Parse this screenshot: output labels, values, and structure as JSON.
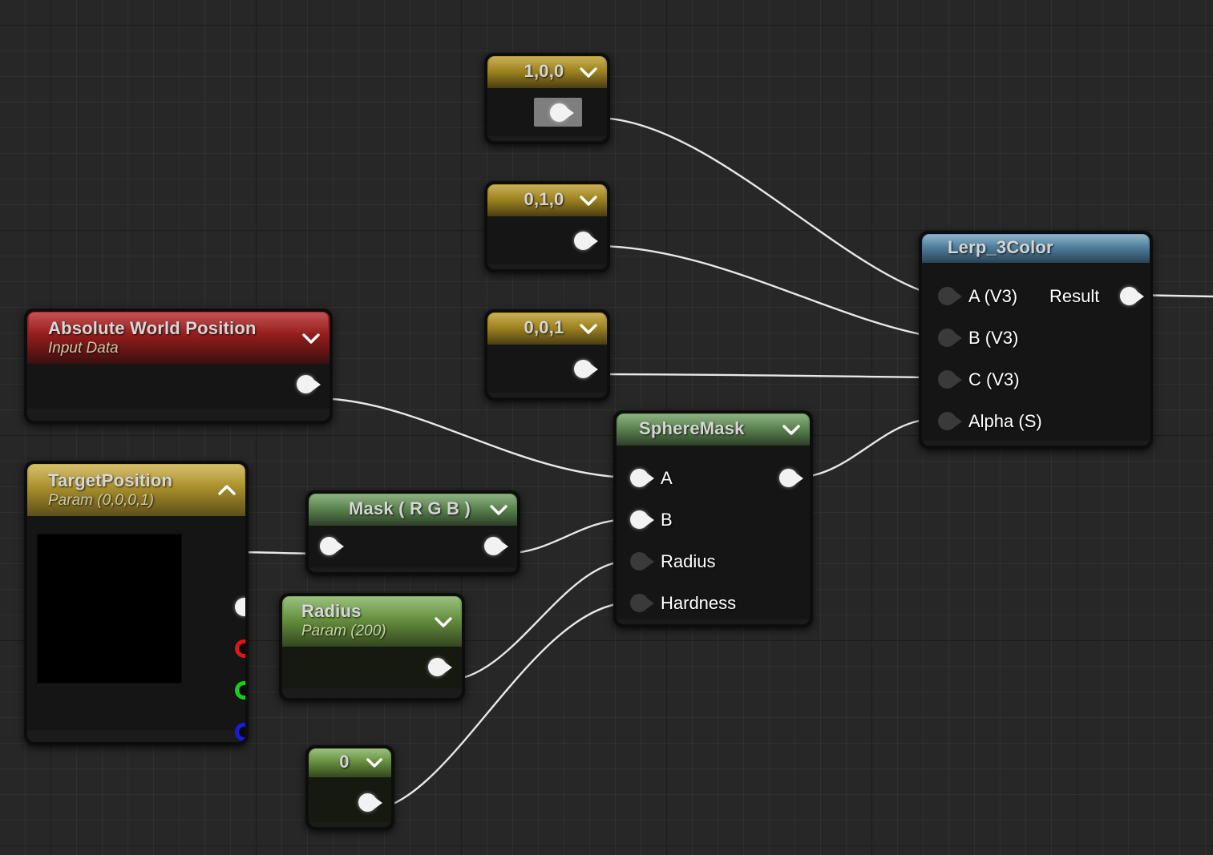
{
  "graph": {
    "title": "Unreal Material Graph",
    "background_color": "#272727",
    "grid_minor_color": "#2f2f2f",
    "grid_major_color": "#1a1a1a",
    "wire_color": "#e8e8e8"
  },
  "nodes": {
    "const_100": {
      "title": "1,0,0",
      "header_color": "#9d8220",
      "chevron": "chevron-down-icon",
      "output_pin": "output-pin",
      "pin_hovered": true
    },
    "const_010": {
      "title": "0,1,0",
      "header_color": "#9d8220",
      "chevron": "chevron-down-icon",
      "output_pin": "output-pin"
    },
    "const_001": {
      "title": "0,0,1",
      "header_color": "#9d8220",
      "chevron": "chevron-down-icon",
      "output_pin": "output-pin"
    },
    "absolute_world_position": {
      "title": "Absolute World Position",
      "subtitle": "Input Data",
      "header_color": "#941c1c",
      "chevron": "chevron-down-icon",
      "output_pin": "output-pin"
    },
    "target_position": {
      "title": "TargetPosition",
      "subtitle": "Param (0,0,0,1)",
      "header_color": "#a98f2c",
      "chevron": "chevron-up-icon",
      "preview_color": "#000000",
      "outputs": [
        {
          "name": "rgba",
          "style": "filled"
        },
        {
          "name": "r",
          "style": "ring-red",
          "color": "#e01414"
        },
        {
          "name": "g",
          "style": "ring-green",
          "color": "#13d413"
        },
        {
          "name": "b",
          "style": "ring-blue",
          "color": "#1a1ae0"
        },
        {
          "name": "a",
          "style": "ring-alpha",
          "color": "#bfbfbf"
        }
      ]
    },
    "mask_rgb": {
      "title": "Mask ( R G B )",
      "header_color": "#5b8450",
      "chevron": "chevron-down-icon",
      "input_pin": "input-pin",
      "output_pin": "output-pin"
    },
    "radius_param": {
      "title": "Radius",
      "subtitle": "Param (200)",
      "header_color": "#66913f",
      "chevron": "chevron-down-icon",
      "output_pin": "output-pin"
    },
    "const_zero": {
      "title": "0",
      "header_color": "#66913f",
      "chevron": "chevron-down-icon",
      "output_pin": "output-pin"
    },
    "sphere_mask": {
      "title": "SphereMask",
      "header_color": "#5b8450",
      "chevron": "chevron-down-icon",
      "inputs": [
        {
          "label": "A",
          "style": "filled"
        },
        {
          "label": "B",
          "style": "filled"
        },
        {
          "label": "Radius",
          "style": "empty"
        },
        {
          "label": "Hardness",
          "style": "empty"
        }
      ],
      "output_pin": "output-pin"
    },
    "lerp_3color": {
      "title": "Lerp_3Color",
      "header_color": "#4d7c99",
      "inputs": [
        {
          "label": "A (V3)",
          "style": "empty"
        },
        {
          "label": "B (V3)",
          "style": "empty"
        },
        {
          "label": "C (V3)",
          "style": "empty"
        },
        {
          "label": "Alpha (S)",
          "style": "empty"
        }
      ],
      "output_label": "Result",
      "output_pin": "output-pin"
    }
  },
  "connections": [
    {
      "from": "const_100",
      "to": "lerp_3color.A"
    },
    {
      "from": "const_010",
      "to": "lerp_3color.B"
    },
    {
      "from": "const_001",
      "to": "lerp_3color.C"
    },
    {
      "from": "absolute_world_position",
      "to": "sphere_mask.A"
    },
    {
      "from": "target_position.rgba",
      "to": "mask_rgb.input"
    },
    {
      "from": "mask_rgb",
      "to": "sphere_mask.B"
    },
    {
      "from": "radius_param",
      "to": "sphere_mask.Radius"
    },
    {
      "from": "const_zero",
      "to": "sphere_mask.Hardness"
    },
    {
      "from": "sphere_mask",
      "to": "lerp_3color.Alpha"
    },
    {
      "from": "lerp_3color.Result",
      "to": "offscreen-right"
    }
  ]
}
